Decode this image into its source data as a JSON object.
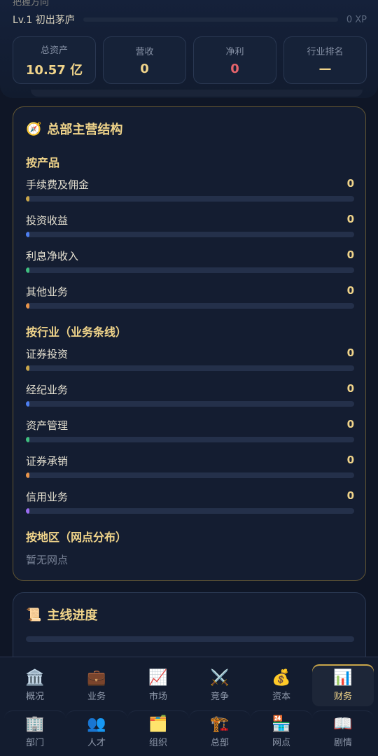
{
  "header": {
    "cut_text": "把握方向",
    "level_text": "Lv.1 初出茅庐",
    "xp_text": "0 XP",
    "stats": [
      {
        "label": "总资产",
        "value": "10.57 亿"
      },
      {
        "label": "营收",
        "value": "0"
      },
      {
        "label": "净利",
        "value": "0"
      },
      {
        "label": "行业排名",
        "value": "—"
      }
    ]
  },
  "structure": {
    "title": "总部主营结构",
    "title_icon": "compass-icon",
    "by_product": {
      "heading": "按产品",
      "items": [
        {
          "label": "手续费及佣金",
          "value": "0",
          "color": "#c9a64a"
        },
        {
          "label": "投资收益",
          "value": "0",
          "color": "#4d7ef0"
        },
        {
          "label": "利息净收入",
          "value": "0",
          "color": "#3fbf7f"
        },
        {
          "label": "其他业务",
          "value": "0",
          "color": "#e8944a"
        }
      ]
    },
    "by_industry": {
      "heading": "按行业（业务条线）",
      "items": [
        {
          "label": "证券投资",
          "value": "0",
          "color": "#c9a64a"
        },
        {
          "label": "经纪业务",
          "value": "0",
          "color": "#4d7ef0"
        },
        {
          "label": "资产管理",
          "value": "0",
          "color": "#3fbf7f"
        },
        {
          "label": "证券承销",
          "value": "0",
          "color": "#e8944a"
        },
        {
          "label": "信用业务",
          "value": "0",
          "color": "#9b6cf0"
        }
      ]
    },
    "by_region": {
      "heading": "按地区（网点分布）",
      "empty_text": "暂无网点"
    }
  },
  "main_progress": {
    "title": "主线进度",
    "title_icon": "scroll-icon"
  },
  "nav": {
    "row1": [
      {
        "label": "概况",
        "icon": "🏛️"
      },
      {
        "label": "业务",
        "icon": "💼"
      },
      {
        "label": "市场",
        "icon": "📈"
      },
      {
        "label": "竞争",
        "icon": "⚔️"
      },
      {
        "label": "资本",
        "icon": "💰"
      },
      {
        "label": "财务",
        "icon": "📊"
      }
    ],
    "row2": [
      {
        "label": "部门",
        "icon": "🏢"
      },
      {
        "label": "人才",
        "icon": "👥"
      },
      {
        "label": "组织",
        "icon": "🗂️"
      },
      {
        "label": "总部",
        "icon": "🏗️"
      },
      {
        "label": "网点",
        "icon": "🏪"
      },
      {
        "label": "剧情",
        "icon": "📖"
      }
    ],
    "active": "财务"
  }
}
